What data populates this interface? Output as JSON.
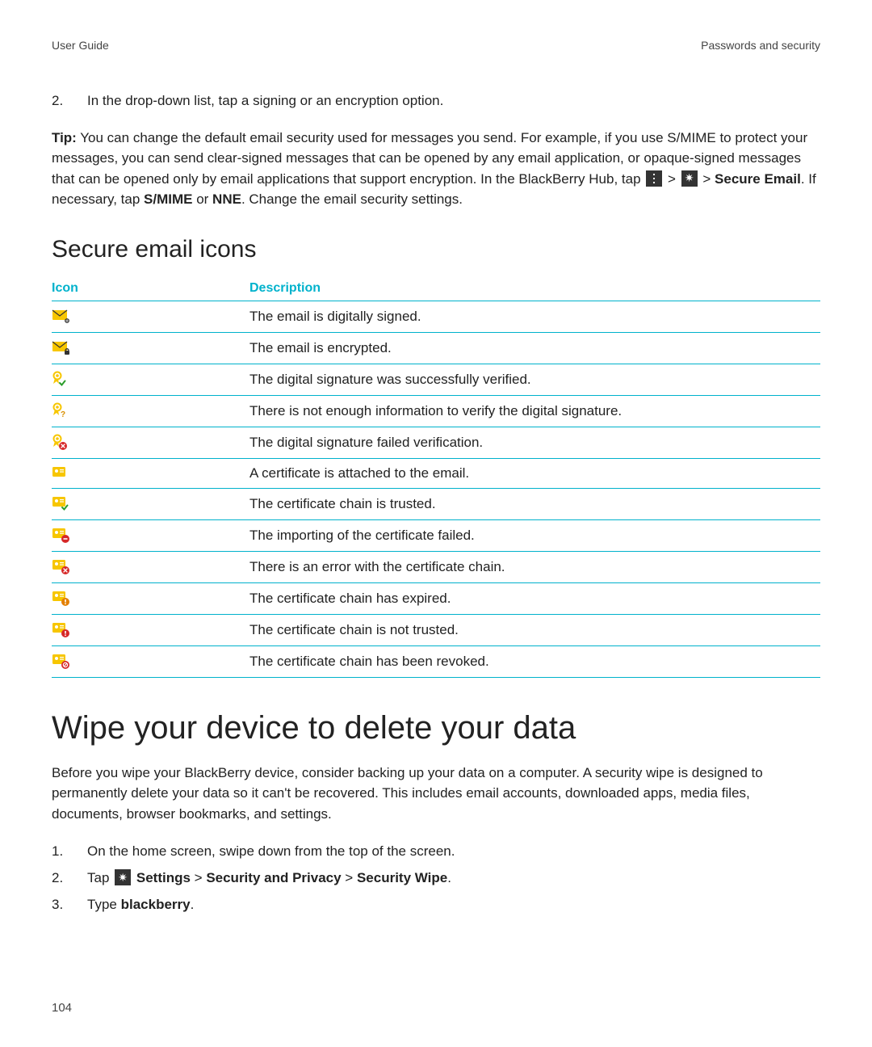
{
  "header": {
    "left": "User Guide",
    "right": "Passwords and security"
  },
  "top_step": {
    "num": "2.",
    "text": "In the drop-down list, tap a signing or an encryption option."
  },
  "tip": {
    "lead": "Tip:",
    "body_part1": " You can change the default email security used for messages you send. For example, if you use S/MIME to protect your messages, you can send clear-signed messages that can be opened by any email application, or opaque-signed messages that can be opened only by email applications that support encryption. In the BlackBerry Hub, tap ",
    "gt1": " > ",
    "gt2": " > ",
    "secure_email": "Secure Email",
    "body_part2": ". If necessary, tap ",
    "smime": "S/MIME",
    "or": " or ",
    "nne": "NNE",
    "body_part3": ". Change the email security settings."
  },
  "section_title": "Secure email icons",
  "table": {
    "col_icon": "Icon",
    "col_desc": "Description",
    "rows": [
      {
        "icon": "email-signed-icon",
        "desc": "The email is digitally signed."
      },
      {
        "icon": "email-encrypted-icon",
        "desc": "The email is encrypted."
      },
      {
        "icon": "signature-verified-icon",
        "desc": "The digital signature was successfully verified."
      },
      {
        "icon": "signature-unknown-icon",
        "desc": "There is not enough information to verify the digital signature."
      },
      {
        "icon": "signature-failed-icon",
        "desc": "The digital signature failed verification."
      },
      {
        "icon": "cert-attached-icon",
        "desc": "A certificate is attached to the email."
      },
      {
        "icon": "cert-trusted-icon",
        "desc": "The certificate chain is trusted."
      },
      {
        "icon": "cert-import-failed-icon",
        "desc": "The importing of the certificate failed."
      },
      {
        "icon": "cert-error-icon",
        "desc": "There is an error with the certificate chain."
      },
      {
        "icon": "cert-expired-icon",
        "desc": "The certificate chain has expired."
      },
      {
        "icon": "cert-untrusted-icon",
        "desc": "The certificate chain is not trusted."
      },
      {
        "icon": "cert-revoked-icon",
        "desc": "The certificate chain has been revoked."
      }
    ]
  },
  "wipe": {
    "title": "Wipe your device to delete your data",
    "intro": "Before you wipe your BlackBerry device, consider backing up your data on a computer. A security wipe is designed to permanently delete your data so it can't be recovered. This includes email accounts, downloaded apps, media files, documents, browser bookmarks, and settings.",
    "steps": [
      {
        "num": "1.",
        "parts": {
          "t0": "On the home screen, swipe down from the top of the screen."
        }
      },
      {
        "num": "2.",
        "parts": {
          "t0": "Tap ",
          "b1": "Settings",
          "sep1": " > ",
          "b2": "Security and Privacy",
          "sep2": " > ",
          "b3": "Security Wipe",
          "end": "."
        }
      },
      {
        "num": "3.",
        "parts": {
          "t0": "Type ",
          "b1": "blackberry",
          "end": "."
        }
      }
    ]
  },
  "page_number": "104"
}
